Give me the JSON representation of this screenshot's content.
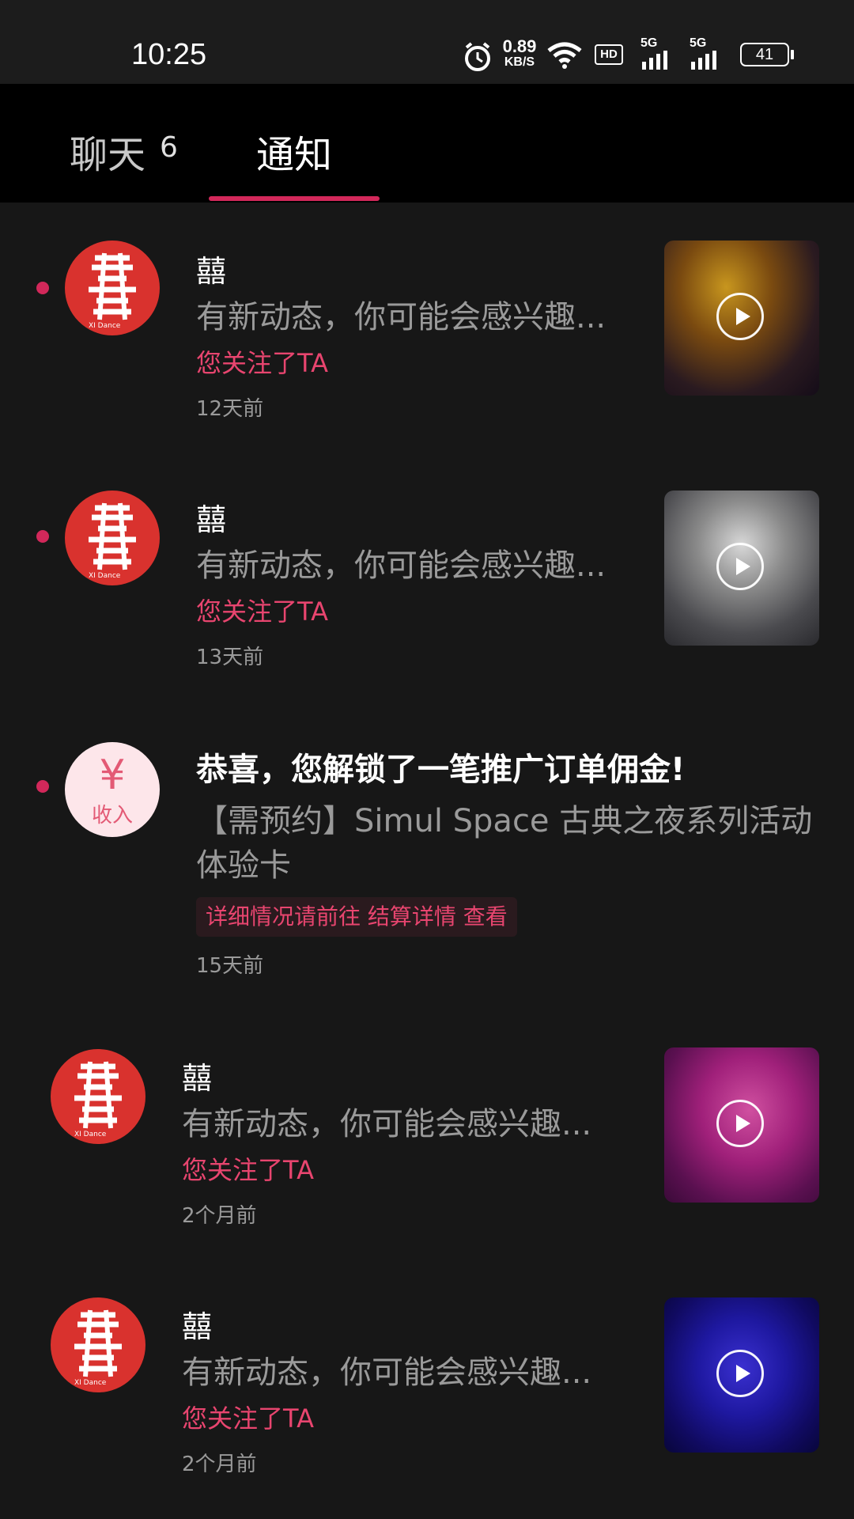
{
  "status": {
    "time": "10:25",
    "net_speed": "0.89",
    "net_unit": "KB/S",
    "hd": "HD",
    "sim1": "5G",
    "sim2": "5G",
    "battery": "41",
    "icons": [
      "alarm-icon",
      "wifi-icon",
      "hd-icon",
      "signal-icon",
      "signal-icon",
      "battery-icon"
    ]
  },
  "tabs": {
    "chat_label": "聊天",
    "chat_badge": "6",
    "notify_label": "通知",
    "active": "通知",
    "accent": "#d2285a"
  },
  "items": [
    {
      "name": "囍",
      "desc": "有新动态，你可能会感兴趣...",
      "follow": "您关注了TA",
      "time": "12天前",
      "unread": true
    },
    {
      "name": "囍",
      "desc": "有新动态，你可能会感兴趣...",
      "follow": "您关注了TA",
      "time": "13天前",
      "unread": true
    },
    {
      "name": "囍",
      "desc": "有新动态，你可能会感兴趣...",
      "follow": "您关注了TA",
      "time": "2个月前",
      "unread": false
    },
    {
      "name": "囍",
      "desc": "有新动态，你可能会感兴趣...",
      "follow": "您关注了TA",
      "time": "2个月前",
      "unread": false
    }
  ],
  "promo": {
    "icon_symbol": "¥",
    "icon_label": "收入",
    "title": "恭喜，您解锁了一笔推广订单佣金!",
    "desc": "【需预约】Simul Space 古典之夜系列活动体验卡",
    "link": "详细情况请前往 结算详情 查看",
    "time": "15天前",
    "unread": true
  }
}
